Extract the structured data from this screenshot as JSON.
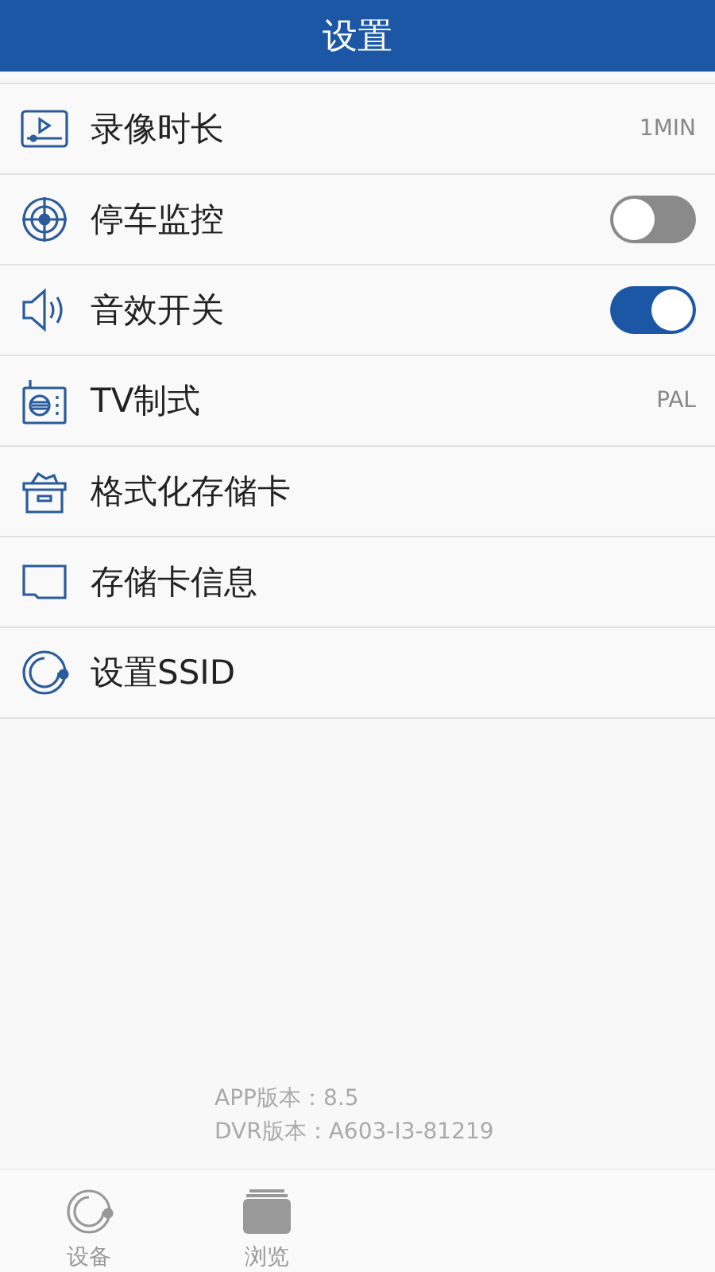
{
  "header": {
    "title": "设置"
  },
  "settings": [
    {
      "label": "录像时长",
      "kind": "value",
      "value": "1MIN"
    },
    {
      "label": "停车监控",
      "kind": "toggle",
      "on": false
    },
    {
      "label": "音效开关",
      "kind": "toggle",
      "on": true
    },
    {
      "label": "TV制式",
      "kind": "value",
      "value": "PAL"
    },
    {
      "label": "格式化存储卡",
      "kind": "plain"
    },
    {
      "label": "存储卡信息",
      "kind": "plain"
    },
    {
      "label": "设置SSID",
      "kind": "plain"
    }
  ],
  "versions": [
    "APP版本：8.5",
    "DVR版本：A603-I3-81219"
  ],
  "tabs": [
    {
      "label": "设备",
      "selected": false
    },
    {
      "label": "浏览",
      "selected": false
    }
  ]
}
